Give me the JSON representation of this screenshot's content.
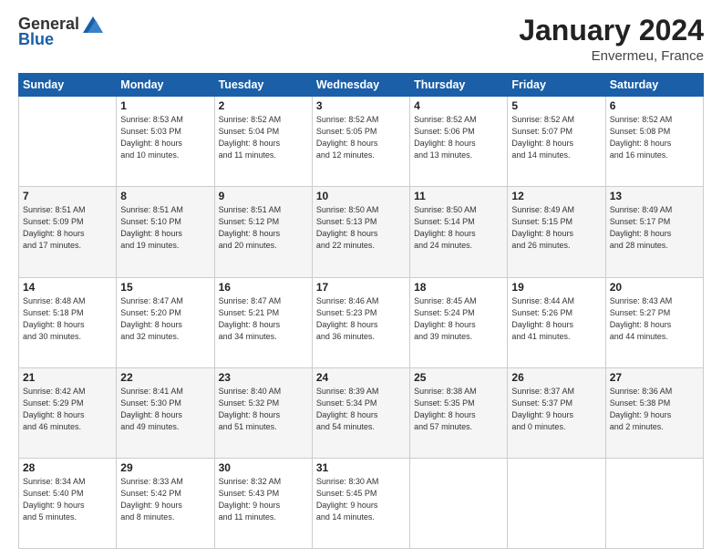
{
  "logo": {
    "general": "General",
    "blue": "Blue"
  },
  "header": {
    "title": "January 2024",
    "location": "Envermeu, France"
  },
  "weekdays": [
    "Sunday",
    "Monday",
    "Tuesday",
    "Wednesday",
    "Thursday",
    "Friday",
    "Saturday"
  ],
  "weeks": [
    [
      {
        "day": "",
        "sunrise": "",
        "sunset": "",
        "daylight": ""
      },
      {
        "day": "1",
        "sunrise": "Sunrise: 8:53 AM",
        "sunset": "Sunset: 5:03 PM",
        "daylight": "Daylight: 8 hours and 10 minutes."
      },
      {
        "day": "2",
        "sunrise": "Sunrise: 8:52 AM",
        "sunset": "Sunset: 5:04 PM",
        "daylight": "Daylight: 8 hours and 11 minutes."
      },
      {
        "day": "3",
        "sunrise": "Sunrise: 8:52 AM",
        "sunset": "Sunset: 5:05 PM",
        "daylight": "Daylight: 8 hours and 12 minutes."
      },
      {
        "day": "4",
        "sunrise": "Sunrise: 8:52 AM",
        "sunset": "Sunset: 5:06 PM",
        "daylight": "Daylight: 8 hours and 13 minutes."
      },
      {
        "day": "5",
        "sunrise": "Sunrise: 8:52 AM",
        "sunset": "Sunset: 5:07 PM",
        "daylight": "Daylight: 8 hours and 14 minutes."
      },
      {
        "day": "6",
        "sunrise": "Sunrise: 8:52 AM",
        "sunset": "Sunset: 5:08 PM",
        "daylight": "Daylight: 8 hours and 16 minutes."
      }
    ],
    [
      {
        "day": "7",
        "sunrise": "Sunrise: 8:51 AM",
        "sunset": "Sunset: 5:09 PM",
        "daylight": "Daylight: 8 hours and 17 minutes."
      },
      {
        "day": "8",
        "sunrise": "Sunrise: 8:51 AM",
        "sunset": "Sunset: 5:10 PM",
        "daylight": "Daylight: 8 hours and 19 minutes."
      },
      {
        "day": "9",
        "sunrise": "Sunrise: 8:51 AM",
        "sunset": "Sunset: 5:12 PM",
        "daylight": "Daylight: 8 hours and 20 minutes."
      },
      {
        "day": "10",
        "sunrise": "Sunrise: 8:50 AM",
        "sunset": "Sunset: 5:13 PM",
        "daylight": "Daylight: 8 hours and 22 minutes."
      },
      {
        "day": "11",
        "sunrise": "Sunrise: 8:50 AM",
        "sunset": "Sunset: 5:14 PM",
        "daylight": "Daylight: 8 hours and 24 minutes."
      },
      {
        "day": "12",
        "sunrise": "Sunrise: 8:49 AM",
        "sunset": "Sunset: 5:15 PM",
        "daylight": "Daylight: 8 hours and 26 minutes."
      },
      {
        "day": "13",
        "sunrise": "Sunrise: 8:49 AM",
        "sunset": "Sunset: 5:17 PM",
        "daylight": "Daylight: 8 hours and 28 minutes."
      }
    ],
    [
      {
        "day": "14",
        "sunrise": "Sunrise: 8:48 AM",
        "sunset": "Sunset: 5:18 PM",
        "daylight": "Daylight: 8 hours and 30 minutes."
      },
      {
        "day": "15",
        "sunrise": "Sunrise: 8:47 AM",
        "sunset": "Sunset: 5:20 PM",
        "daylight": "Daylight: 8 hours and 32 minutes."
      },
      {
        "day": "16",
        "sunrise": "Sunrise: 8:47 AM",
        "sunset": "Sunset: 5:21 PM",
        "daylight": "Daylight: 8 hours and 34 minutes."
      },
      {
        "day": "17",
        "sunrise": "Sunrise: 8:46 AM",
        "sunset": "Sunset: 5:23 PM",
        "daylight": "Daylight: 8 hours and 36 minutes."
      },
      {
        "day": "18",
        "sunrise": "Sunrise: 8:45 AM",
        "sunset": "Sunset: 5:24 PM",
        "daylight": "Daylight: 8 hours and 39 minutes."
      },
      {
        "day": "19",
        "sunrise": "Sunrise: 8:44 AM",
        "sunset": "Sunset: 5:26 PM",
        "daylight": "Daylight: 8 hours and 41 minutes."
      },
      {
        "day": "20",
        "sunrise": "Sunrise: 8:43 AM",
        "sunset": "Sunset: 5:27 PM",
        "daylight": "Daylight: 8 hours and 44 minutes."
      }
    ],
    [
      {
        "day": "21",
        "sunrise": "Sunrise: 8:42 AM",
        "sunset": "Sunset: 5:29 PM",
        "daylight": "Daylight: 8 hours and 46 minutes."
      },
      {
        "day": "22",
        "sunrise": "Sunrise: 8:41 AM",
        "sunset": "Sunset: 5:30 PM",
        "daylight": "Daylight: 8 hours and 49 minutes."
      },
      {
        "day": "23",
        "sunrise": "Sunrise: 8:40 AM",
        "sunset": "Sunset: 5:32 PM",
        "daylight": "Daylight: 8 hours and 51 minutes."
      },
      {
        "day": "24",
        "sunrise": "Sunrise: 8:39 AM",
        "sunset": "Sunset: 5:34 PM",
        "daylight": "Daylight: 8 hours and 54 minutes."
      },
      {
        "day": "25",
        "sunrise": "Sunrise: 8:38 AM",
        "sunset": "Sunset: 5:35 PM",
        "daylight": "Daylight: 8 hours and 57 minutes."
      },
      {
        "day": "26",
        "sunrise": "Sunrise: 8:37 AM",
        "sunset": "Sunset: 5:37 PM",
        "daylight": "Daylight: 9 hours and 0 minutes."
      },
      {
        "day": "27",
        "sunrise": "Sunrise: 8:36 AM",
        "sunset": "Sunset: 5:38 PM",
        "daylight": "Daylight: 9 hours and 2 minutes."
      }
    ],
    [
      {
        "day": "28",
        "sunrise": "Sunrise: 8:34 AM",
        "sunset": "Sunset: 5:40 PM",
        "daylight": "Daylight: 9 hours and 5 minutes."
      },
      {
        "day": "29",
        "sunrise": "Sunrise: 8:33 AM",
        "sunset": "Sunset: 5:42 PM",
        "daylight": "Daylight: 9 hours and 8 minutes."
      },
      {
        "day": "30",
        "sunrise": "Sunrise: 8:32 AM",
        "sunset": "Sunset: 5:43 PM",
        "daylight": "Daylight: 9 hours and 11 minutes."
      },
      {
        "day": "31",
        "sunrise": "Sunrise: 8:30 AM",
        "sunset": "Sunset: 5:45 PM",
        "daylight": "Daylight: 9 hours and 14 minutes."
      },
      {
        "day": "",
        "sunrise": "",
        "sunset": "",
        "daylight": ""
      },
      {
        "day": "",
        "sunrise": "",
        "sunset": "",
        "daylight": ""
      },
      {
        "day": "",
        "sunrise": "",
        "sunset": "",
        "daylight": ""
      }
    ]
  ]
}
